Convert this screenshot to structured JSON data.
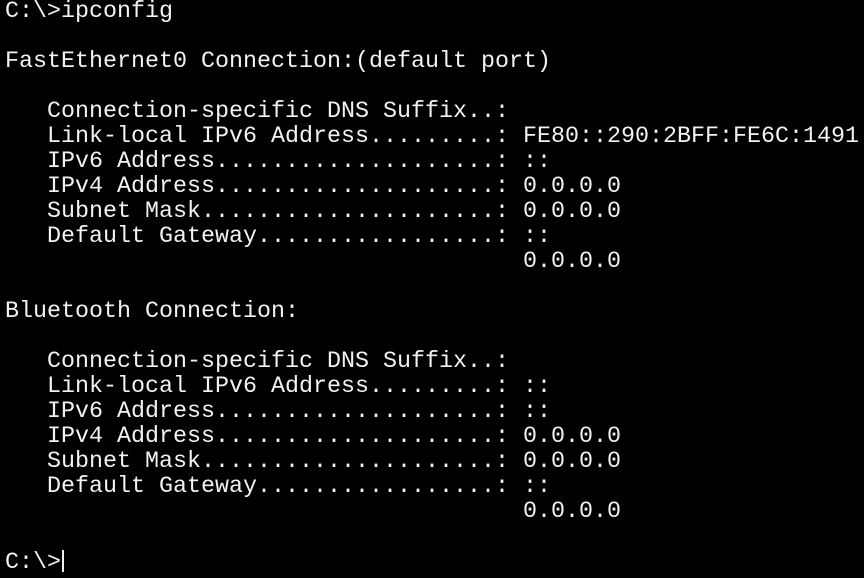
{
  "terminal": {
    "colors": {
      "background": "#000000",
      "text": "#f2f2f2"
    },
    "lines": [
      "C:\\>ipconfig",
      "",
      "FastEthernet0 Connection:(default port)",
      "",
      "   Connection-specific DNS Suffix..:",
      "   Link-local IPv6 Address.........: FE80::290:2BFF:FE6C:1491",
      "   IPv6 Address....................: ::",
      "   IPv4 Address....................: 0.0.0.0",
      "   Subnet Mask.....................: 0.0.0.0",
      "   Default Gateway.................: ::",
      "                                     0.0.0.0",
      "",
      "Bluetooth Connection:",
      "",
      "   Connection-specific DNS Suffix..:",
      "   Link-local IPv6 Address.........: ::",
      "   IPv6 Address....................: ::",
      "   IPv4 Address....................: 0.0.0.0",
      "   Subnet Mask.....................: 0.0.0.0",
      "   Default Gateway.................: ::",
      "                                     0.0.0.0",
      ""
    ],
    "prompt": "C:\\>"
  }
}
